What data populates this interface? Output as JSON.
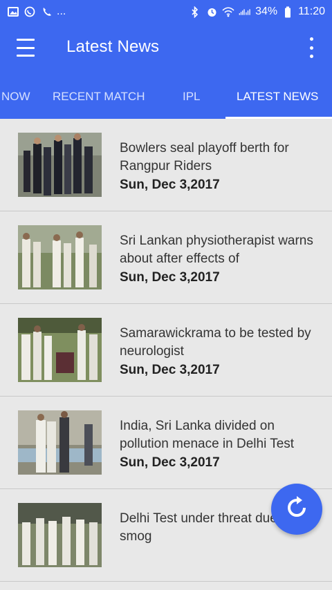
{
  "status_bar": {
    "left_text": "...",
    "battery": "34%",
    "time": "11:20"
  },
  "app_bar": {
    "title": "Latest News"
  },
  "tabs": [
    {
      "label": "NOW"
    },
    {
      "label": "RECENT MATCH"
    },
    {
      "label": "IPL"
    },
    {
      "label": "LATEST NEWS"
    }
  ],
  "news": [
    {
      "title": "Bowlers seal playoff berth for Rangpur Riders",
      "date": "Sun, Dec 3,2017"
    },
    {
      "title": "Sri Lankan physiotherapist warns about after effects of",
      "date": "Sun, Dec 3,2017"
    },
    {
      "title": "Samarawickrama to be tested by neurologist",
      "date": "Sun, Dec 3,2017"
    },
    {
      "title": "India, Sri Lanka divided on pollution menace in Delhi Test",
      "date": "Sun, Dec 3,2017"
    },
    {
      "title": "Delhi Test under threat due to smog"
    }
  ],
  "colors": {
    "primary": "#3d68f0",
    "background": "#e8e8e8",
    "text": "#333333"
  },
  "icons": {
    "status_left": [
      "image-icon",
      "whatsapp-icon",
      "phone-icon"
    ],
    "status_right": [
      "bluetooth-icon",
      "alarm-icon",
      "wifi-icon",
      "signal-icon",
      "battery-icon"
    ],
    "fab": "refresh-icon"
  }
}
